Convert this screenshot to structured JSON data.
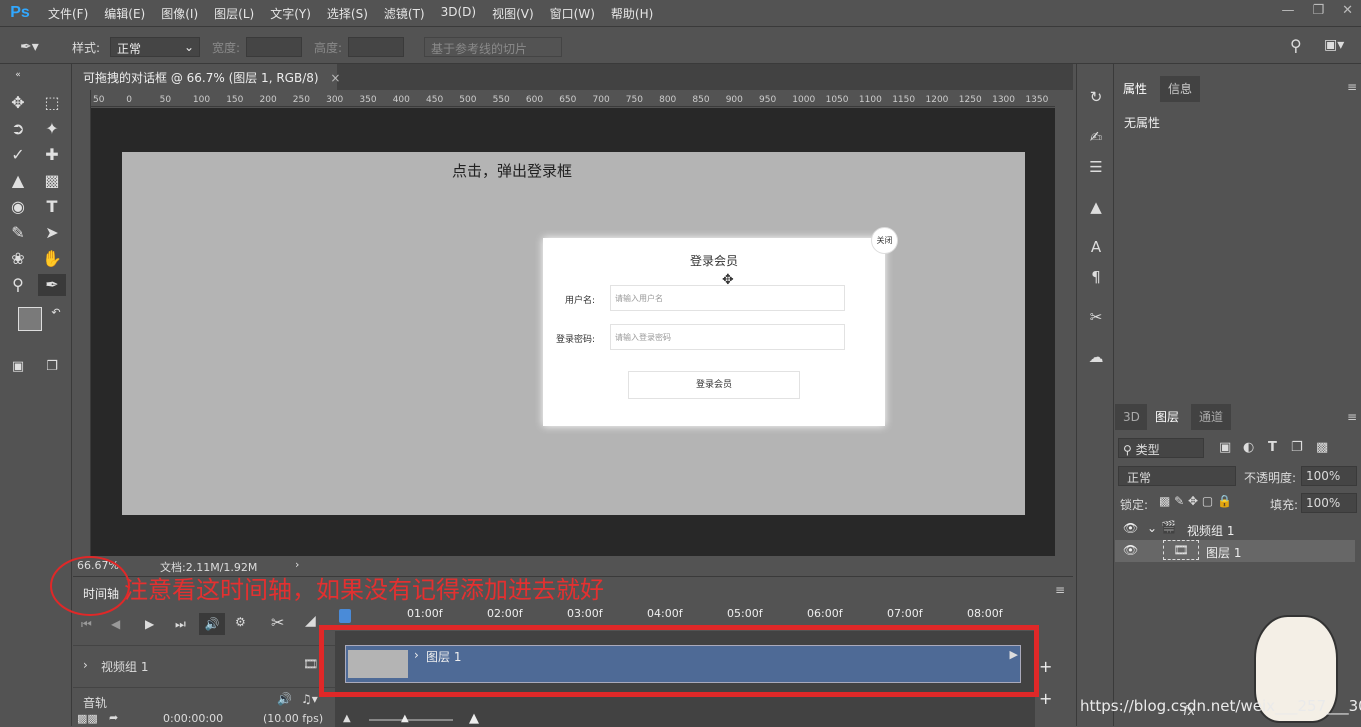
{
  "app": {
    "logo": "Ps"
  },
  "menubar": {
    "items": [
      "文件(F)",
      "编辑(E)",
      "图像(I)",
      "图层(L)",
      "文字(Y)",
      "选择(S)",
      "滤镜(T)",
      "3D(D)",
      "视图(V)",
      "窗口(W)",
      "帮助(H)"
    ]
  },
  "options": {
    "style_label": "样式:",
    "style_value": "正常",
    "width_label": "宽度:",
    "height_label": "高度:",
    "slice_button": "基于参考线的切片"
  },
  "document": {
    "tab_title": "可拖拽的对话框 @ 66.7% (图层 1, RGB/8)",
    "ruler_ticks": [
      "50",
      "0",
      "50",
      "100",
      "150",
      "200",
      "250",
      "300",
      "350",
      "400",
      "450",
      "500",
      "550",
      "600",
      "650",
      "700",
      "750",
      "800",
      "850",
      "900",
      "950",
      "1000",
      "1050",
      "1100",
      "1150",
      "1200",
      "1250",
      "1300",
      "1350"
    ],
    "zoom": "66.67%",
    "doc_info": "文档:2.11M/1.92M"
  },
  "canvas": {
    "title": "点击，弹出登录框",
    "dialog_title": "登录会员",
    "username_label": "用户名:",
    "username_placeholder": "请输入用户名",
    "password_label": "登录密码:",
    "password_placeholder": "请输入登录密码",
    "submit": "登录会员",
    "close": "关闭"
  },
  "timeline": {
    "tab": "时间轴",
    "note": "注意看这时间轴，如果没有记得添加进去就好",
    "times": [
      "01:00f",
      "02:00f",
      "03:00f",
      "04:00f",
      "05:00f",
      "06:00f",
      "07:00f",
      "08:00f"
    ],
    "group_track": "视频组 1",
    "audio_track": "音轨",
    "clip_name": "图层 1",
    "timecode": "0:00:00:00",
    "fps": "(10.00 fps)"
  },
  "properties": {
    "tabs": [
      "属性",
      "信息"
    ],
    "empty_text": "无属性"
  },
  "layers": {
    "tabs": [
      "3D",
      "图层",
      "通道"
    ],
    "filter_kind": "类型",
    "blend_mode": "正常",
    "opacity_label": "不透明度:",
    "opacity_value": "100%",
    "lock_label": "锁定:",
    "fill_label": "填充:",
    "fill_value": "100%",
    "items": [
      {
        "name": "视频组 1"
      },
      {
        "name": "图层 1"
      }
    ]
  },
  "watermark": "https://blog.csdn.net/weix___257___30"
}
